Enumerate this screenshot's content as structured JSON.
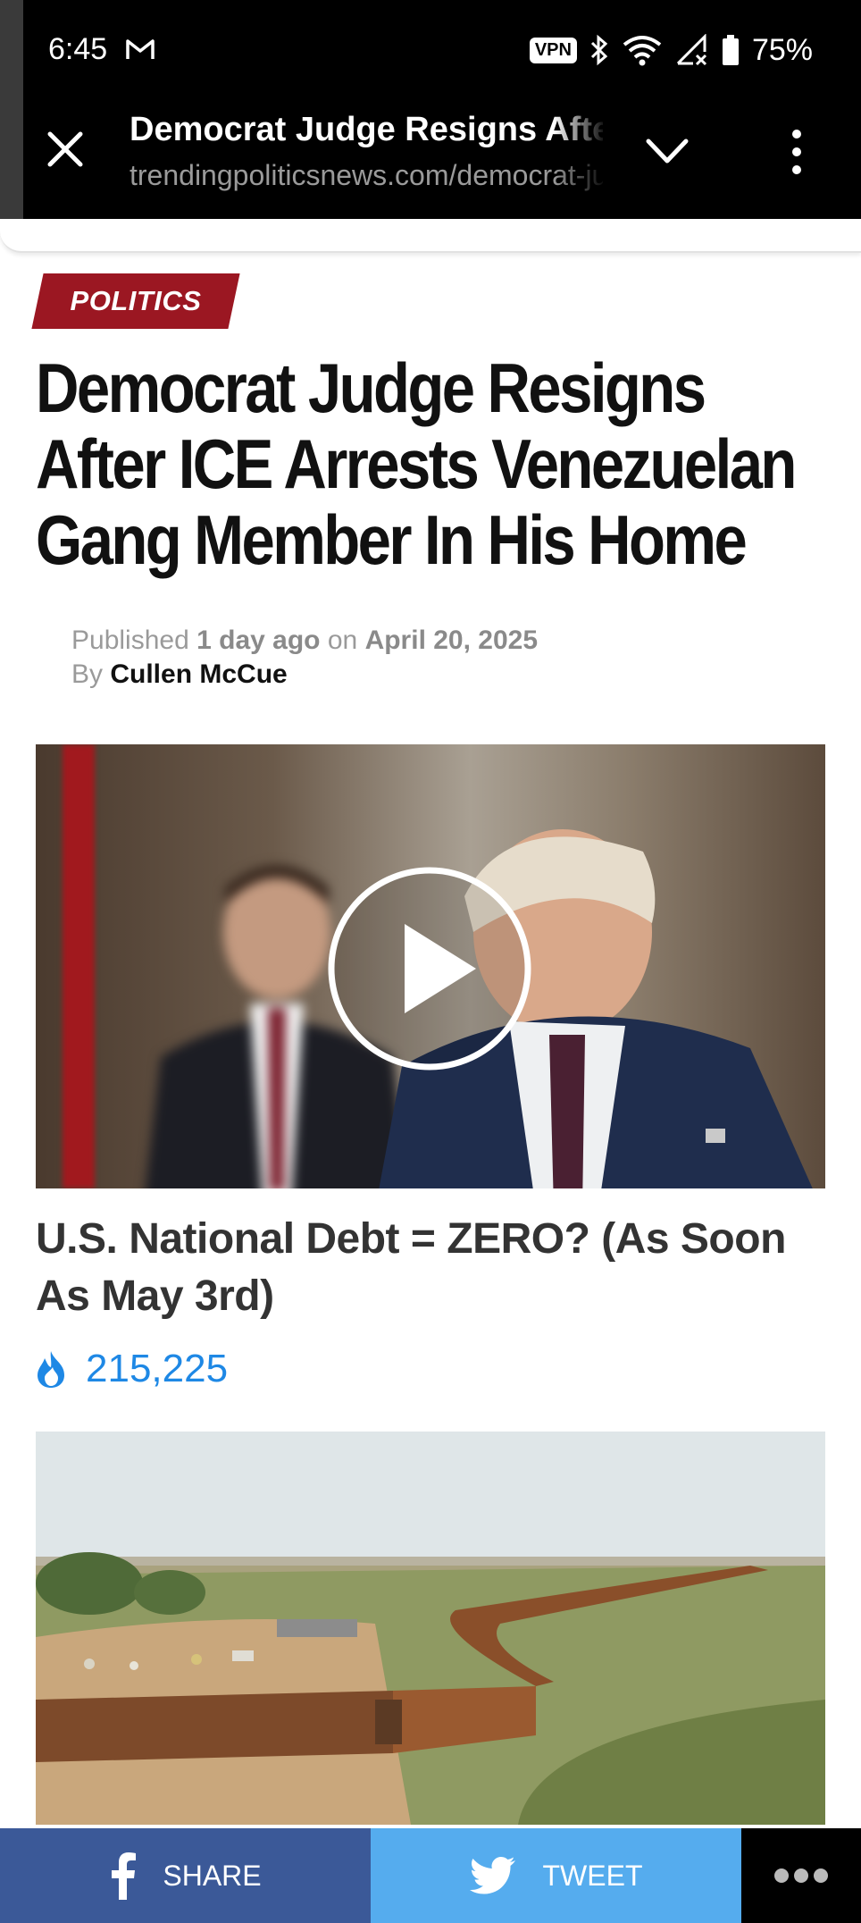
{
  "status_bar": {
    "time": "6:45",
    "mail_icon": "gmail-icon",
    "vpn_label": "VPN",
    "battery": "75%"
  },
  "toolbar": {
    "title": "Democrat Judge Resigns After ICE Arrests Venezuelan Gang Member In His Home",
    "url": "trendingpoliticsnews.com/democrat-judge-resigns"
  },
  "article": {
    "category": "POLITICS",
    "headline_lines": [
      "Democrat Judge Resigns",
      "After ICE Arrests Venezuelan",
      "Gang Member In His Home"
    ],
    "published_prefix": "Published",
    "published_relative": "1 day ago",
    "published_on": "on",
    "published_date": "April 20, 2025",
    "by_prefix": "By",
    "author": "Cullen McCue"
  },
  "ad": {
    "title": "U.S. National Debt = ZERO? (As Soon As May 3rd)",
    "count": "215,225",
    "count_icon": "flame-icon"
  },
  "share_bar": {
    "share_label": "SHARE",
    "tweet_label": "TWEET"
  },
  "colors": {
    "badge": "#9b1722",
    "facebook": "#3b5998",
    "twitter": "#55acee",
    "count_blue": "#1e88e5"
  }
}
